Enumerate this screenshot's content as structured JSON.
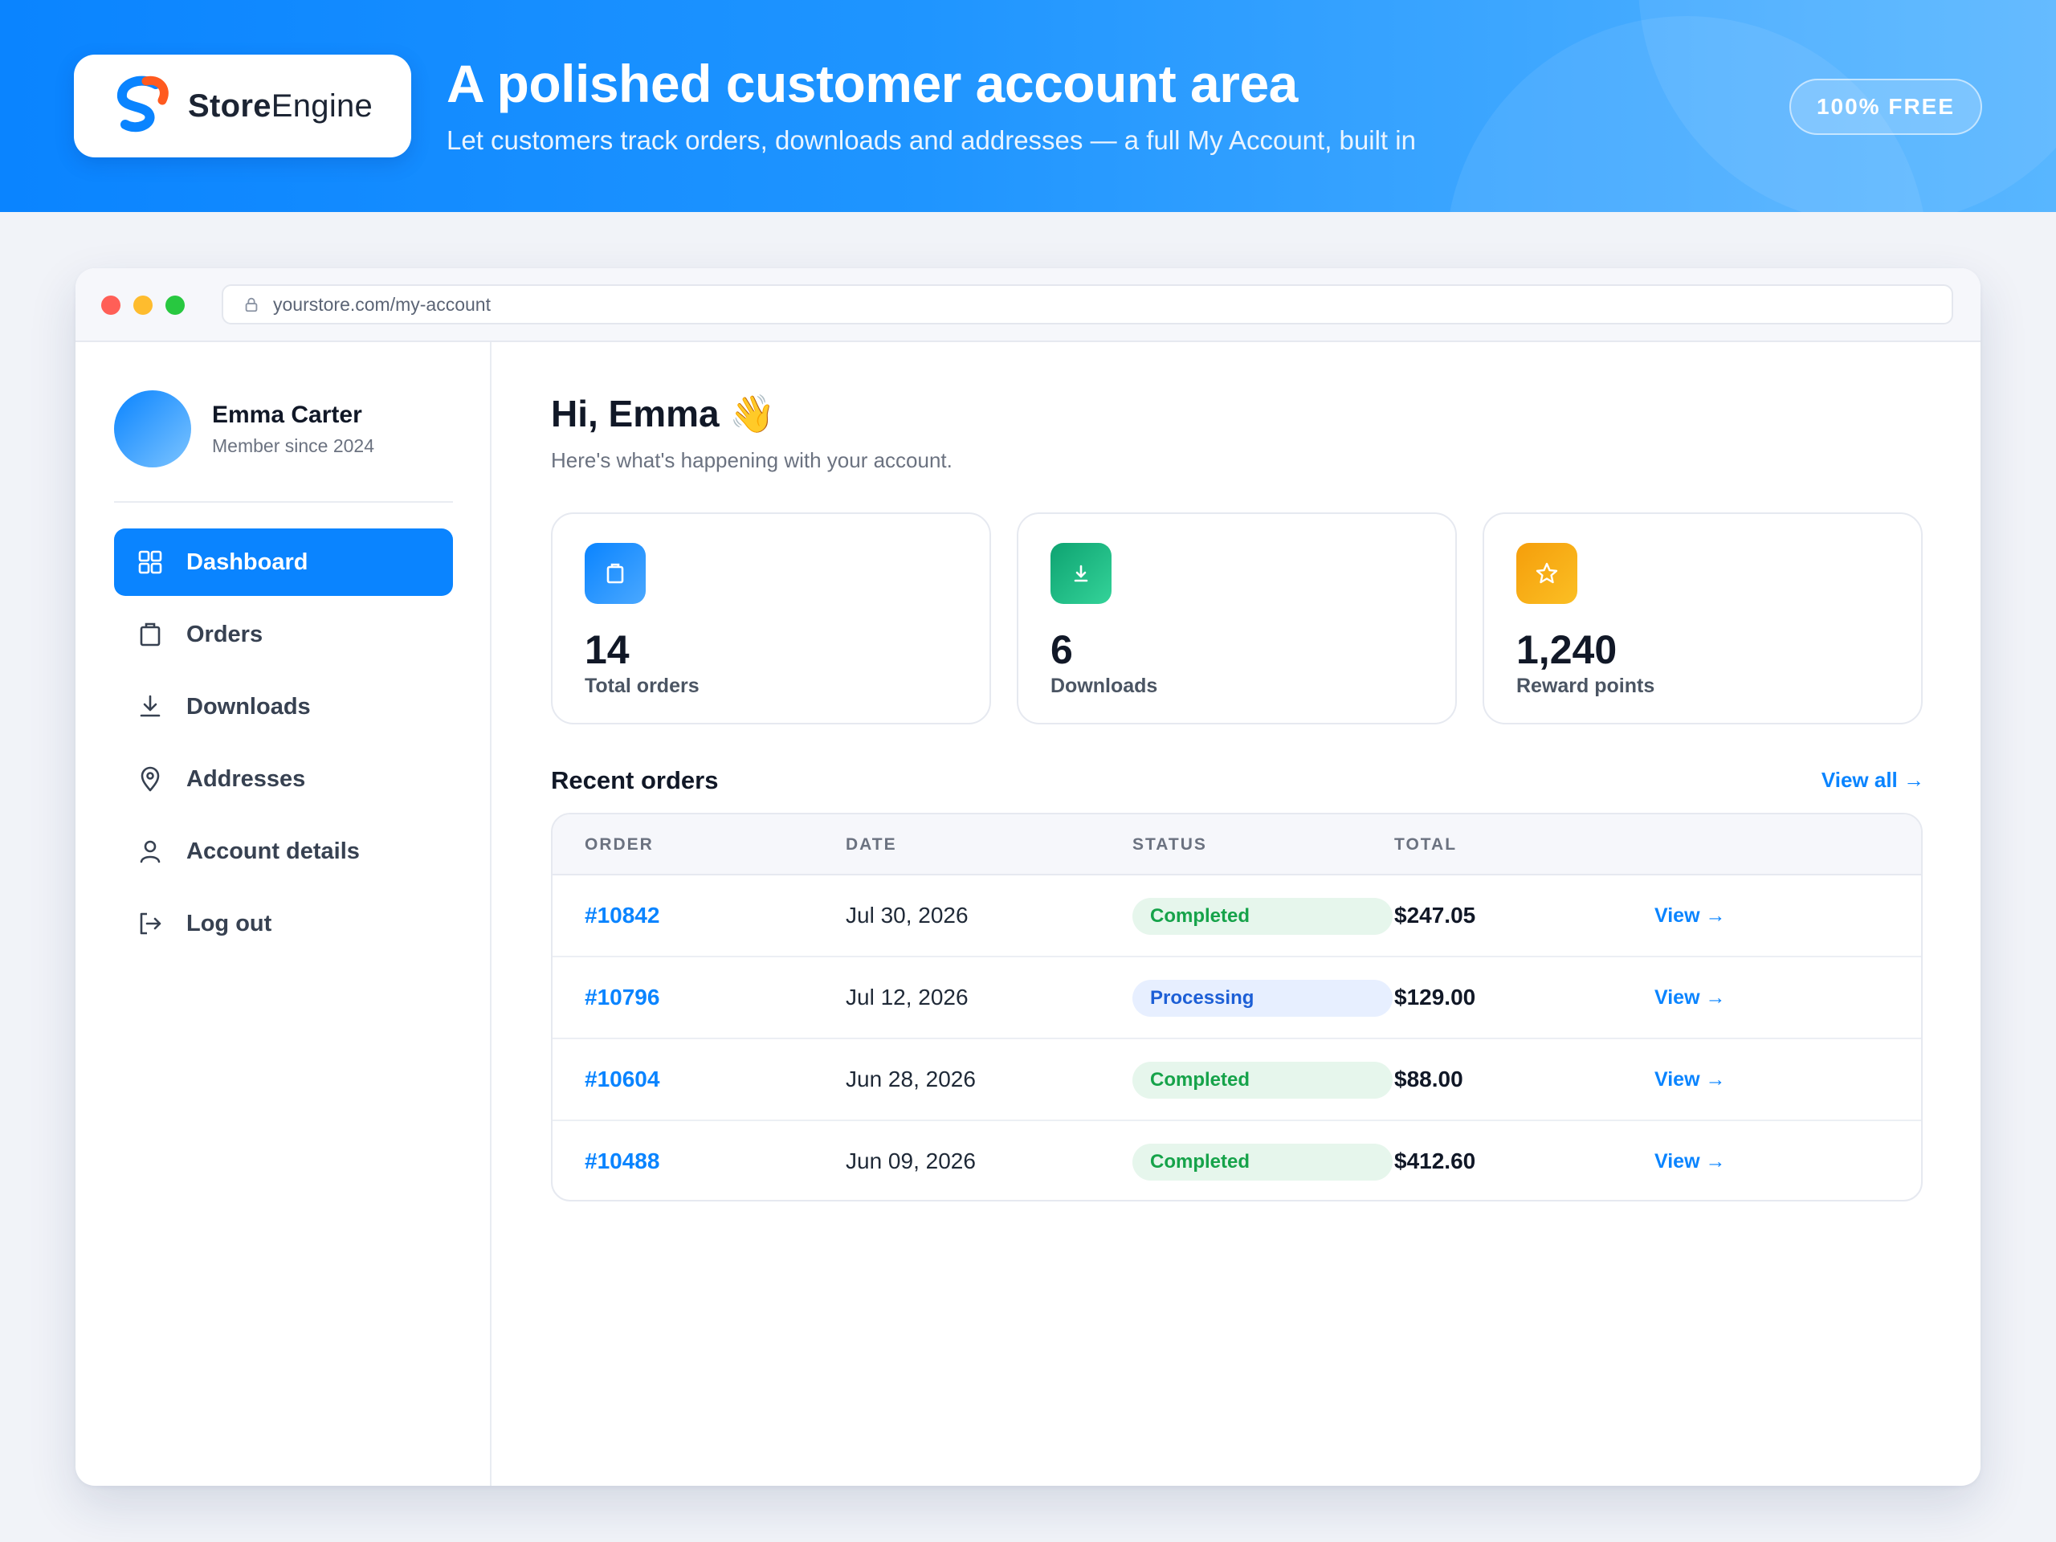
{
  "banner": {
    "brand_bold": "Store",
    "brand_light": "Engine",
    "title": "A polished customer account area",
    "subtitle": "Let customers track orders, downloads and addresses — a full My Account, built in",
    "badge": "100% FREE",
    "colors": {
      "gradient_start": "#0a84ff",
      "gradient_end": "#58b6ff"
    }
  },
  "browser": {
    "url": "yourstore.com/my-account"
  },
  "sidebar": {
    "user_name": "Emma Carter",
    "user_sub": "Member since 2024",
    "items": [
      {
        "label": "Dashboard",
        "icon": "grid-icon",
        "active": true
      },
      {
        "label": "Orders",
        "icon": "bag-icon",
        "active": false
      },
      {
        "label": "Downloads",
        "icon": "download-icon",
        "active": false
      },
      {
        "label": "Addresses",
        "icon": "map-pin-icon",
        "active": false
      },
      {
        "label": "Account details",
        "icon": "user-icon",
        "active": false
      },
      {
        "label": "Log out",
        "icon": "logout-icon",
        "active": false
      }
    ]
  },
  "main": {
    "greeting": "Hi, Emma",
    "greeting_emoji": "👋",
    "greeting_sub": "Here's what's happening with your account.",
    "stats": [
      {
        "value": "14",
        "label": "Total orders",
        "icon": "bag-icon",
        "color": "#0a84ff"
      },
      {
        "value": "6",
        "label": "Downloads",
        "icon": "download-icon",
        "color": "#10b981"
      },
      {
        "value": "1,240",
        "label": "Reward points",
        "icon": "star-icon",
        "color": "#f59e0b"
      }
    ],
    "recent_title": "Recent orders",
    "view_all": "View all →",
    "table": {
      "headers": [
        "ORDER",
        "DATE",
        "STATUS",
        "TOTAL"
      ],
      "rows": [
        {
          "order": "#10842",
          "date": "Jul 30, 2026",
          "status": "Completed",
          "total": "$247.05",
          "action": "View →"
        },
        {
          "order": "#10796",
          "date": "Jul 12, 2026",
          "status": "Processing",
          "total": "$129.00",
          "action": "View →"
        },
        {
          "order": "#10604",
          "date": "Jun 28, 2026",
          "status": "Completed",
          "total": "$88.00",
          "action": "View →"
        },
        {
          "order": "#10488",
          "date": "Jun 09, 2026",
          "status": "Completed",
          "total": "$412.60",
          "action": "View →"
        }
      ]
    }
  }
}
